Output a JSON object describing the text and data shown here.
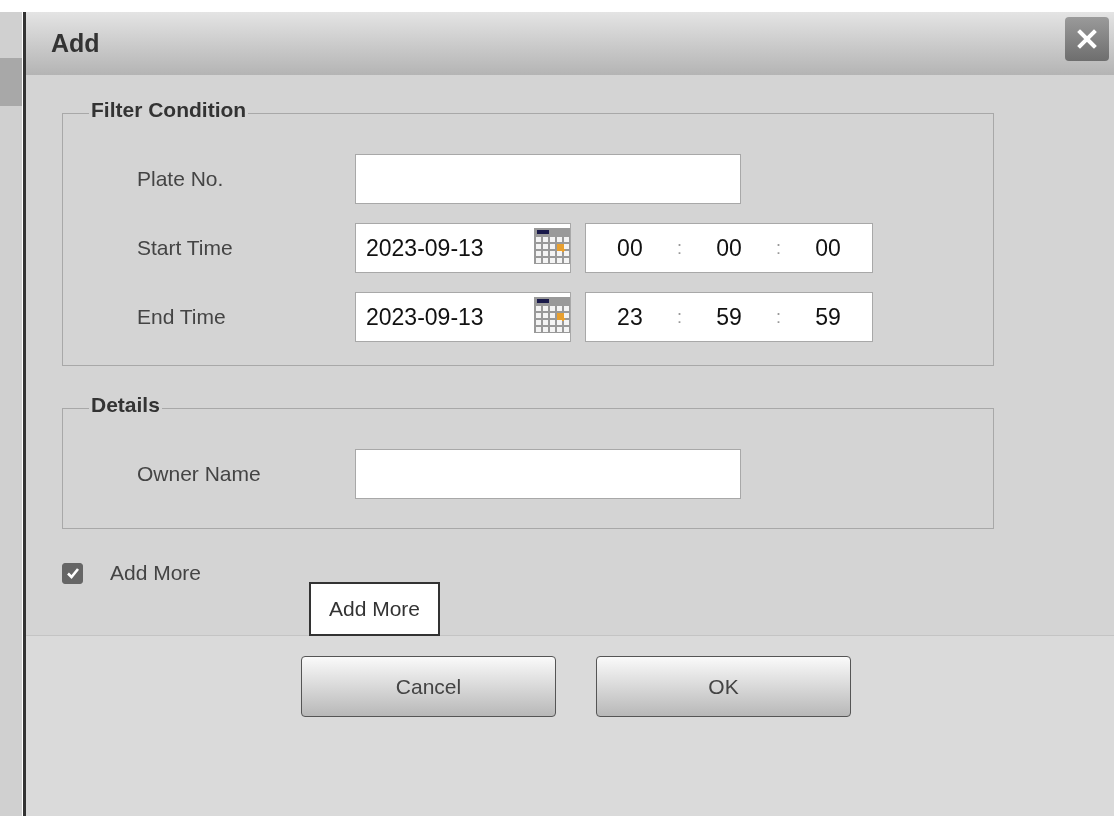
{
  "dialog": {
    "title": "Add"
  },
  "sections": [
    {
      "legend": "Filter Condition",
      "fields": [
        {
          "kind": "text",
          "label": "Plate No."
        },
        {
          "kind": "datetime",
          "label": "Start Time",
          "date": "2023-09-13",
          "hour": "00",
          "minute": "00",
          "second": "00",
          "separator": ":"
        },
        {
          "kind": "datetime",
          "label": "End Time",
          "date": "2023-09-13",
          "hour": "23",
          "minute": "59",
          "second": "59",
          "separator": ":"
        }
      ]
    },
    {
      "legend": "Details",
      "fields": [
        {
          "kind": "text",
          "label": "Owner Name"
        }
      ]
    }
  ],
  "add_more": {
    "label": "Add More",
    "checked": true,
    "tooltip": "Add More"
  },
  "buttons": [
    "Cancel",
    "OK"
  ]
}
